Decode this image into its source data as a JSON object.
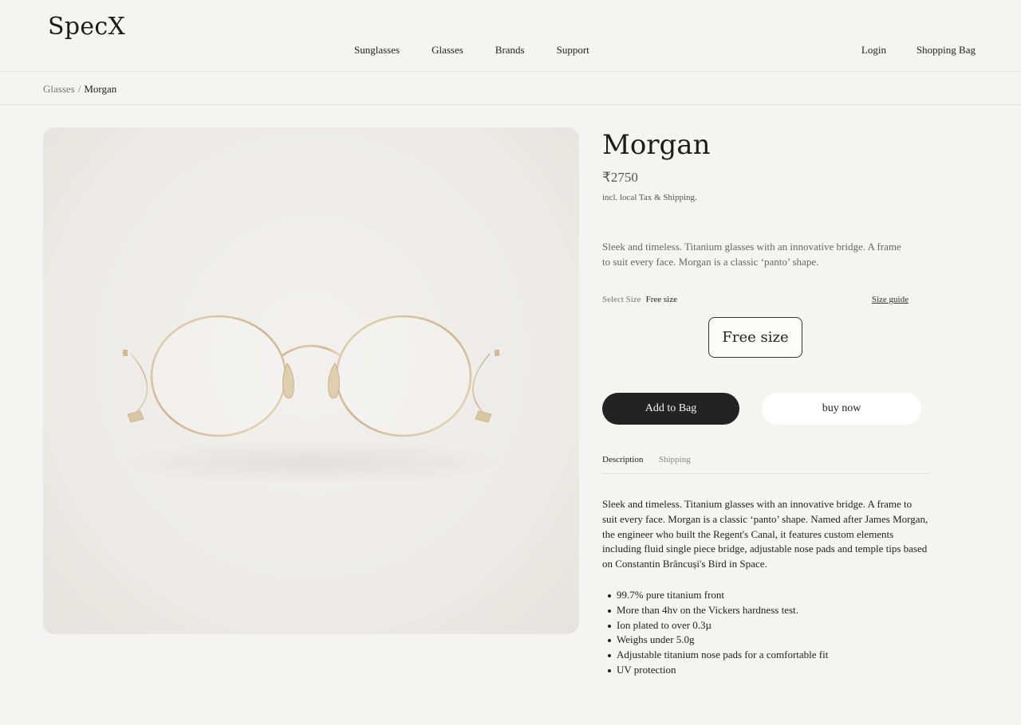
{
  "brand": {
    "logo": "SpecX"
  },
  "nav": {
    "items": [
      "Sunglasses",
      "Glasses",
      "Brands",
      "Support"
    ],
    "login": "Login",
    "bag": "Shopping Bag"
  },
  "breadcrumb": {
    "parent": "Glasses",
    "separator": "/",
    "current": "Morgan"
  },
  "product": {
    "image_icon": "round-titanium-glasses-image",
    "title": "Morgan",
    "price": "₹2750",
    "tax_note": "incl. local Tax & Shipping.",
    "short_description": "Sleek and timeless. Titanium glasses with an innovative bridge. A frame to suit every face. Morgan is a classic ‘panto’ shape.",
    "size": {
      "label": "Select Size",
      "selected": "Free size",
      "guide_link": "Size guide",
      "options": [
        "Free size"
      ]
    },
    "add_to_bag": "Add to Bag",
    "buy_now": "buy now",
    "tabs": [
      "Description",
      "Shipping"
    ],
    "long_description": "Sleek and timeless. Titanium glasses with an innovative bridge. A frame to suit every face. Morgan is a classic ‘panto’ shape. Named after James Morgan, the engineer who built the Regent's Canal, it features custom elements including fluid single piece bridge, adjustable nose pads and temple tips based on Constantin Brâncuși's Bird in Space.",
    "features": [
      "99.7% pure titanium front",
      "More than 4hv on the Vickers hardness test.",
      "Ion plated to over 0.3µ",
      "Weighs under 5.0g",
      "Adjustable titanium nose pads for a comfortable fit",
      "UV protection"
    ]
  },
  "colors": {
    "background": "#f4f4f2",
    "text": "#222222",
    "button_dark": "#232323",
    "frame_gold": "#d8c4a0"
  }
}
